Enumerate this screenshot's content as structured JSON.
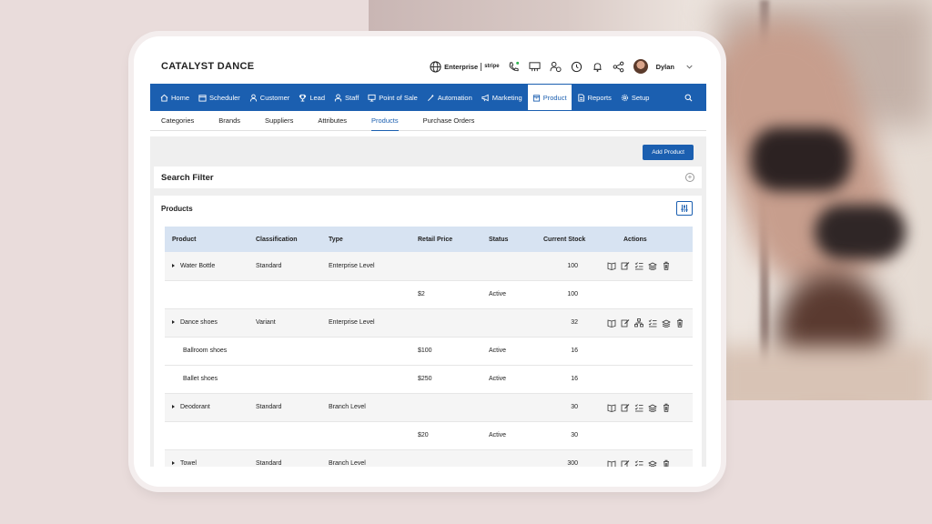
{
  "app": {
    "brand": "CATALYST DANCE"
  },
  "header": {
    "plan": "Enterprise",
    "payment": "stripe",
    "user": "Dylan"
  },
  "nav": {
    "items": [
      {
        "label": "Home",
        "icon": "home-icon"
      },
      {
        "label": "Scheduler",
        "icon": "calendar-icon"
      },
      {
        "label": "Customer",
        "icon": "user-icon"
      },
      {
        "label": "Lead",
        "icon": "trophy-icon"
      },
      {
        "label": "Staff",
        "icon": "staff-icon"
      },
      {
        "label": "Point of Sale",
        "icon": "monitor-icon"
      },
      {
        "label": "Automation",
        "icon": "wand-icon"
      },
      {
        "label": "Marketing",
        "icon": "megaphone-icon"
      },
      {
        "label": "Product",
        "icon": "box-icon"
      },
      {
        "label": "Reports",
        "icon": "report-icon"
      },
      {
        "label": "Setup",
        "icon": "gear-icon"
      }
    ],
    "active": "Product"
  },
  "subnav": {
    "items": [
      "Categories",
      "Brands",
      "Suppliers",
      "Attributes",
      "Products",
      "Purchase Orders"
    ],
    "active": "Products"
  },
  "actions": {
    "add_product": "Add Product"
  },
  "filter": {
    "title": "Search Filter"
  },
  "products": {
    "title": "Products",
    "columns": [
      "Product",
      "Classification",
      "Type",
      "Retail Price",
      "Status",
      "Current Stock",
      "Actions"
    ],
    "rows": [
      {
        "kind": "parent",
        "product": "Water Bottle",
        "classification": "Standard",
        "type": "Enterprise Level",
        "price": "",
        "status": "",
        "stock": "100"
      },
      {
        "kind": "child",
        "product": "",
        "classification": "",
        "type": "",
        "price": "$2",
        "status": "Active",
        "stock": "100"
      },
      {
        "kind": "parent",
        "product": "Dance shoes",
        "classification": "Variant",
        "type": "Enterprise Level",
        "price": "",
        "status": "",
        "stock": "32"
      },
      {
        "kind": "child",
        "product": "Ballroom shoes",
        "classification": "",
        "type": "",
        "price": "$100",
        "status": "Active",
        "stock": "16"
      },
      {
        "kind": "child",
        "product": "Ballet shoes",
        "classification": "",
        "type": "",
        "price": "$250",
        "status": "Active",
        "stock": "16"
      },
      {
        "kind": "parent",
        "product": "Deodorant",
        "classification": "Standard",
        "type": "Branch Level",
        "price": "",
        "status": "",
        "stock": "30"
      },
      {
        "kind": "child",
        "product": "",
        "classification": "",
        "type": "",
        "price": "$20",
        "status": "Active",
        "stock": "30"
      },
      {
        "kind": "parent",
        "product": "Towel",
        "classification": "Standard",
        "type": "Branch Level",
        "price": "",
        "status": "",
        "stock": "300"
      }
    ]
  },
  "colors": {
    "primary": "#1b5fb0",
    "header_row": "#d7e3f2"
  }
}
